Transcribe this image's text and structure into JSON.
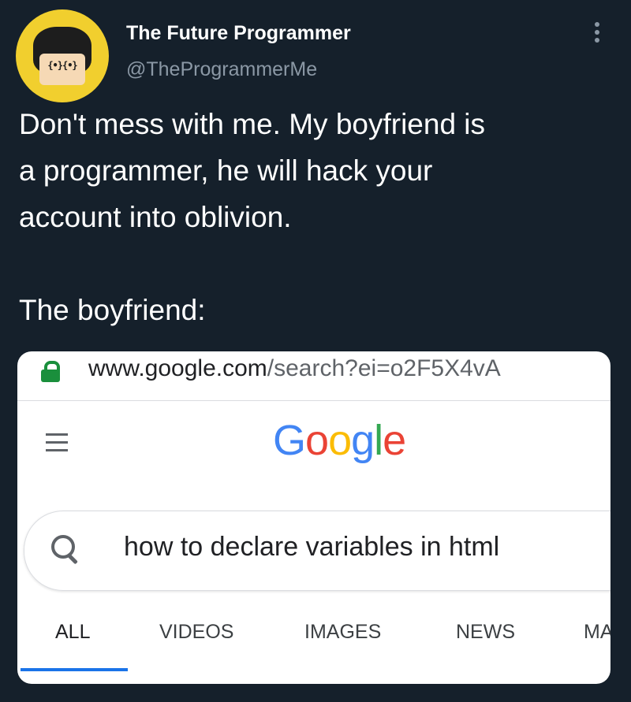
{
  "tweet": {
    "author_name": "The Future Programmer",
    "author_handle": "@TheProgrammerMe",
    "avatar_glasses_text": "{•}{•}",
    "lines": [
      "Don't mess with me. My boyfriend is",
      "a programmer, he will hack your",
      "account into oblivion."
    ],
    "line_after_gap": "The boyfriend:"
  },
  "screenshot": {
    "url_domain": "www.google.com",
    "url_path": "/search?ei=o2F5X4vA",
    "logo_letters": [
      "G",
      "o",
      "o",
      "g",
      "l",
      "e"
    ],
    "search_query": "how to declare variables in html",
    "tabs": [
      {
        "label": "ALL",
        "active": true
      },
      {
        "label": "VIDEOS",
        "active": false
      },
      {
        "label": "IMAGES",
        "active": false
      },
      {
        "label": "NEWS",
        "active": false
      },
      {
        "label": "MA",
        "active": false
      }
    ]
  },
  "colors": {
    "background": "#15202b",
    "accent_tab": "#1a73e8",
    "lock": "#1a8f3c"
  }
}
